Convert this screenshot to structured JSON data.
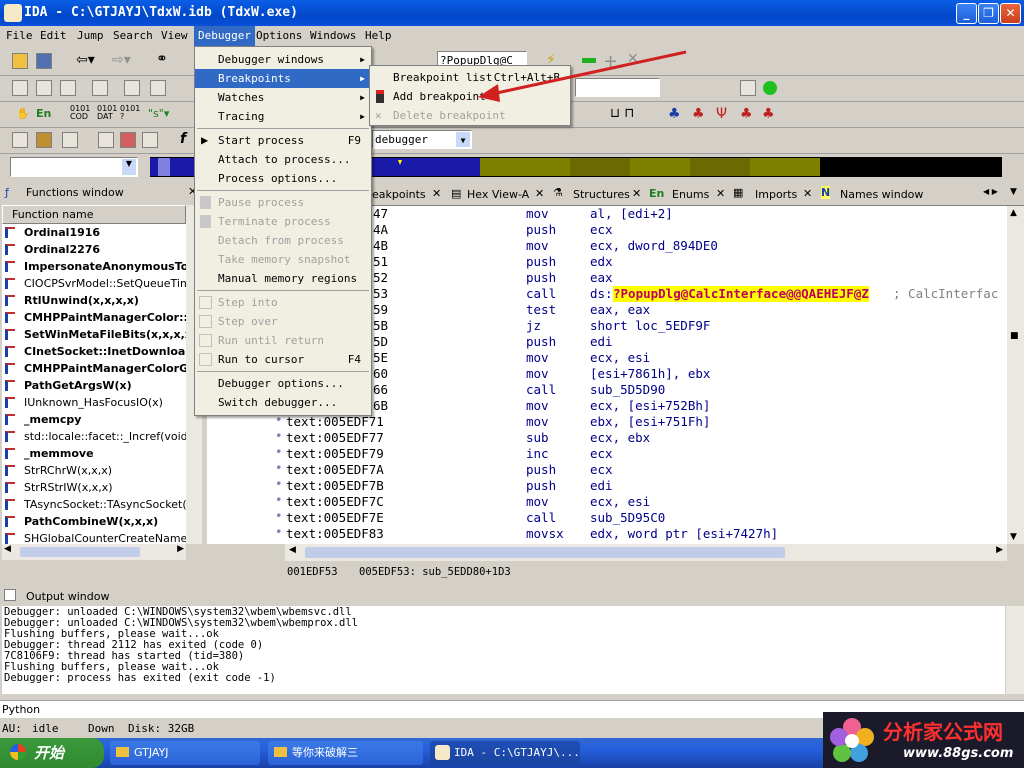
{
  "window": {
    "title": "IDA - C:\\GTJAYJ\\TdxW.idb (TdxW.exe)"
  },
  "menubar": [
    "File",
    "Edit",
    "Jump",
    "Search",
    "View",
    "Debugger",
    "Options",
    "Windows",
    "Help"
  ],
  "toolbar": {
    "combo_popup": "?PopupDlg@C",
    "combo_debugger": "debugger"
  },
  "debugger_menu": {
    "items": [
      {
        "label": "Debugger windows",
        "shortcut": "",
        "submenu": true,
        "disabled": false
      },
      {
        "label": "Breakpoints",
        "shortcut": "",
        "submenu": true,
        "disabled": false,
        "selected": true
      },
      {
        "label": "Watches",
        "shortcut": "",
        "submenu": true,
        "disabled": false
      },
      {
        "label": "Tracing",
        "shortcut": "",
        "submenu": true,
        "disabled": false
      },
      {
        "label": "Start process",
        "shortcut": "F9",
        "disabled": false
      },
      {
        "label": "Attach to process...",
        "shortcut": "",
        "disabled": false
      },
      {
        "label": "Process options...",
        "shortcut": "",
        "disabled": false
      },
      {
        "label": "Pause process",
        "shortcut": "",
        "disabled": true
      },
      {
        "label": "Terminate process",
        "shortcut": "",
        "disabled": true
      },
      {
        "label": "Detach from process",
        "shortcut": "",
        "disabled": true
      },
      {
        "label": "Take memory snapshot",
        "shortcut": "",
        "disabled": true
      },
      {
        "label": "Manual memory regions",
        "shortcut": "",
        "disabled": false
      },
      {
        "label": "Step into",
        "shortcut": "",
        "disabled": true
      },
      {
        "label": "Step over",
        "shortcut": "",
        "disabled": true
      },
      {
        "label": "Run until return",
        "shortcut": "",
        "disabled": true
      },
      {
        "label": "Run to cursor",
        "shortcut": "F4",
        "disabled": false
      },
      {
        "label": "Debugger options...",
        "shortcut": "",
        "disabled": false
      },
      {
        "label": "Switch debugger...",
        "shortcut": "",
        "disabled": false
      }
    ]
  },
  "breakpoints_submenu": {
    "items": [
      {
        "label": "Breakpoint list",
        "shortcut": "Ctrl+Alt+B",
        "disabled": false
      },
      {
        "label": "Add breakpoint",
        "shortcut": "",
        "disabled": false
      },
      {
        "label": "Delete breakpoint",
        "shortcut": "",
        "disabled": true
      }
    ]
  },
  "tabs": [
    "eakpoints",
    "Hex View-A",
    "Structures",
    "Enums",
    "Imports",
    "Names window"
  ],
  "functions_window": {
    "title": "Functions window",
    "column": "Function name",
    "items": [
      {
        "name": "Ordinal1916",
        "bold": true
      },
      {
        "name": "Ordinal2276",
        "bold": true
      },
      {
        "name": "ImpersonateAnonymousToke",
        "bold": true
      },
      {
        "name": "CIOCPSvrModel::SetQueueTimeo",
        "bold": false
      },
      {
        "name": "RtlUnwind(x,x,x,x)",
        "bold": true
      },
      {
        "name": "CMHPPaintManagerColor::op",
        "bold": true
      },
      {
        "name": "SetWinMetaFileBits(x,x,x,x)",
        "bold": true
      },
      {
        "name": "CInetSocket::InetDownload(",
        "bold": true
      },
      {
        "name": "CMHPPaintManagerColorGra",
        "bold": true
      },
      {
        "name": "PathGetArgsW(x)",
        "bold": true
      },
      {
        "name": "IUnknown_HasFocusIO(x)",
        "bold": false
      },
      {
        "name": "_memcpy",
        "bold": true
      },
      {
        "name": "std::locale::facet::_Incref(void)",
        "bold": false
      },
      {
        "name": "_memmove",
        "bold": true
      },
      {
        "name": "StrRChrW(x,x,x)",
        "bold": false
      },
      {
        "name": "StrRStrIW(x,x,x)",
        "bold": false
      },
      {
        "name": "TAsyncSocket::TAsyncSocket(TA",
        "bold": false
      },
      {
        "name": "PathCombineW(x,x,x)",
        "bold": true
      },
      {
        "name": "SHGlobalCounterCreateNamedW(",
        "bold": false
      }
    ]
  },
  "disasm": {
    "rows": [
      {
        "addr": "47",
        "mn": "mov",
        "ops": "al, [edi+2]"
      },
      {
        "addr": "4A",
        "mn": "push",
        "ops": "ecx"
      },
      {
        "addr": "4B",
        "mn": "mov",
        "ops": "ecx, dword_894DE0"
      },
      {
        "addr": "51",
        "mn": "push",
        "ops": "edx"
      },
      {
        "addr": "52",
        "mn": "push",
        "ops": "eax"
      },
      {
        "addr": "53",
        "mn": "call",
        "ops": "ds:",
        "hl": "?PopupDlg@CalcInterface@@QAEHEJF@Z",
        "cmt": "; CalcInterfac"
      },
      {
        "addr": "59",
        "mn": "test",
        "ops": "eax, eax"
      },
      {
        "addr": "5B",
        "mn": "jz",
        "ops": "short loc_5EDF9F"
      },
      {
        "addr": "5D",
        "mn": "push",
        "ops": "edi"
      },
      {
        "addr": "5E",
        "mn": "mov",
        "ops": "ecx, esi"
      },
      {
        "addr": "60",
        "mn": "mov",
        "ops": "[esi+7861h], ebx"
      },
      {
        "addr": "66",
        "mn": "call",
        "ops": "sub_5D5D90"
      },
      {
        "addr": "6B",
        "mn": "mov",
        "ops": "ecx, [esi+752Bh]"
      },
      {
        "addr": "text:005EDF71",
        "mn": "mov",
        "ops": "ebx, [esi+751Fh]"
      },
      {
        "addr": "text:005EDF77",
        "mn": "sub",
        "ops": "ecx, ebx"
      },
      {
        "addr": "text:005EDF79",
        "mn": "inc",
        "ops": "ecx"
      },
      {
        "addr": "text:005EDF7A",
        "mn": "push",
        "ops": "ecx"
      },
      {
        "addr": "text:005EDF7B",
        "mn": "push",
        "ops": "edi"
      },
      {
        "addr": "text:005EDF7C",
        "mn": "mov",
        "ops": "ecx, esi"
      },
      {
        "addr": "text:005EDF7E",
        "mn": "call",
        "ops": "sub_5D95C0"
      },
      {
        "addr": "text:005EDF83",
        "mn": "movsx",
        "ops": "edx, word ptr [esi+7427h]"
      }
    ],
    "status_left": "001EDF53",
    "status_right": "005EDF53: sub_5EDD80+1D3"
  },
  "output_window": {
    "title": "Output window",
    "lines": [
      "Debugger: unloaded C:\\WINDOWS\\system32\\wbem\\wbemsvc.dll",
      "Debugger: unloaded C:\\WINDOWS\\system32\\wbem\\wbemprox.dll",
      "Flushing buffers, please wait...ok",
      "Debugger: thread 2112 has exited (code 0)",
      "7C8106F9: thread has started (tid=380)",
      "Flushing buffers, please wait...ok",
      "Debugger: process has exited (exit code -1)"
    ]
  },
  "python_label": "Python",
  "statusbar": {
    "au": "AU:",
    "state": "idle",
    "dir": "Down",
    "disk": "Disk: 32GB"
  },
  "taskbar": {
    "start": "开始",
    "tasks": [
      "GTJAYJ",
      "等你来破解三",
      "IDA - C:\\GTJAYJ\\..."
    ]
  },
  "watermark": {
    "name": "分析家公式网",
    "url": "www.88gs.com"
  },
  "colors": {
    "highlight": "#ffff00",
    "menu_selected": "#316ac5",
    "arrow": "#d02020"
  }
}
